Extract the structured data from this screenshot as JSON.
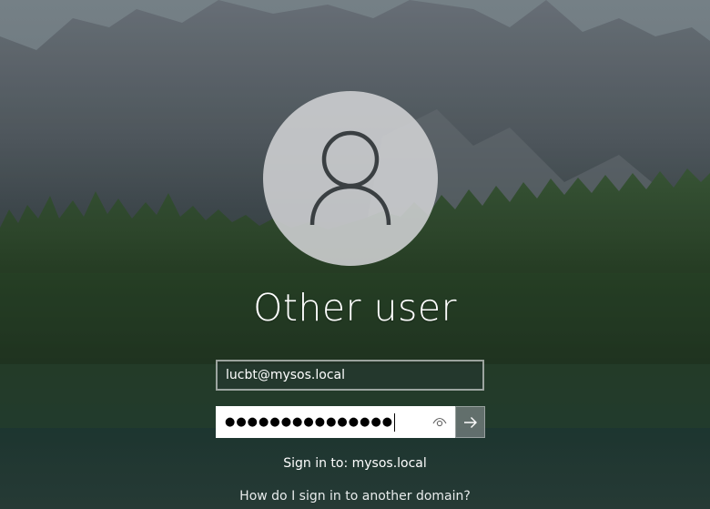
{
  "login": {
    "user_name": "Other user",
    "username_value": "lucbt@mysos.local",
    "password_masked": "●●●●●●●●●●●●●●●",
    "sign_in_to": "Sign in to: mysos.local",
    "other_domain_link": "How do I sign in to another domain?"
  },
  "icons": {
    "avatar": "user-silhouette-icon",
    "reveal": "eye-icon",
    "submit": "arrow-right-icon"
  },
  "colors": {
    "avatar_circle": "#d0d2d4",
    "avatar_glyph": "#3a3f42",
    "text": "#ffffff",
    "submit_bg": "#788282"
  }
}
